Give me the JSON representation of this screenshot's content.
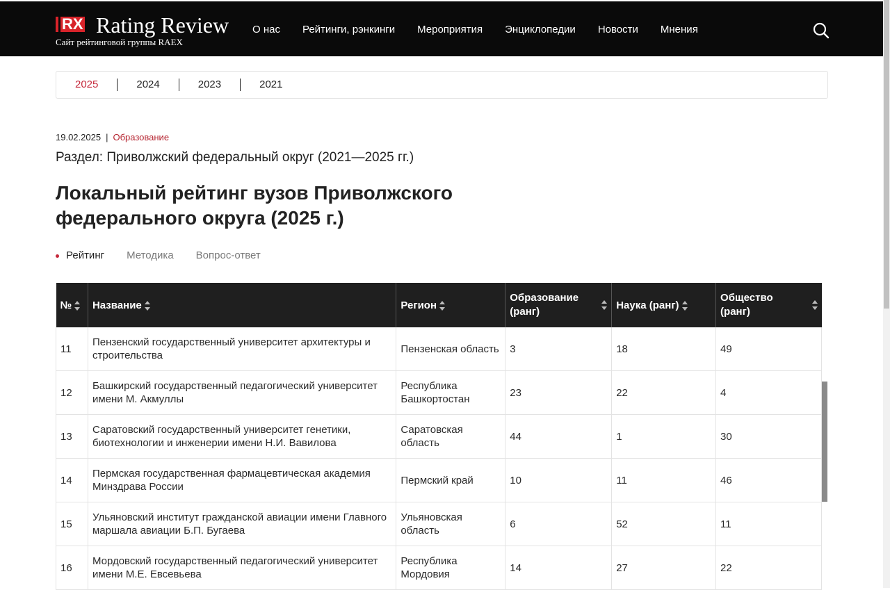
{
  "header": {
    "logo_mark": "RX",
    "logo_title": "Rating Review",
    "logo_subtitle": "Сайт рейтинговой группы RAEX",
    "nav": [
      "О нас",
      "Рейтинги, рэнкинги",
      "Мероприятия",
      "Энциклопедии",
      "Новости",
      "Мнения"
    ]
  },
  "years": [
    "2025",
    "2024",
    "2023",
    "2021"
  ],
  "meta": {
    "date": "19.02.2025",
    "separator": "|",
    "category": "Образование"
  },
  "section": "Раздел: Приволжский федеральный округ (2021—2025 гг.)",
  "title": "Локальный рейтинг вузов Приволжского федерального округа (2025 г.)",
  "subtabs": [
    "Рейтинг",
    "Методика",
    "Вопрос-ответ"
  ],
  "table": {
    "headers": [
      "№",
      "Название",
      "Регион",
      "Образование (ранг)",
      "Наука (ранг)",
      "Общество (ранг)"
    ],
    "rows": [
      [
        "11",
        "Пензенский государственный университет архитектуры и строительства",
        "Пензенская область",
        "3",
        "18",
        "49"
      ],
      [
        "12",
        "Башкирский государственный педагогический университет имени М. Акмуллы",
        "Республика Башкортостан",
        "23",
        "22",
        "4"
      ],
      [
        "13",
        "Саратовский государственный университет генетики, биотехнологии и инженерии имени Н.И. Вавилова",
        "Саратовская область",
        "44",
        "1",
        "30"
      ],
      [
        "14",
        "Пермская государственная фармацевтическая академия Минздрава России",
        "Пермский край",
        "10",
        "11",
        "46"
      ],
      [
        "15",
        "Ульяновский институт гражданской авиации имени Главного маршала авиации Б.П. Бугаева",
        "Ульяновская область",
        "6",
        "52",
        "11"
      ],
      [
        "16",
        "Мордовский государственный педагогический университет имени М.Е. Евсевьева",
        "Республика Мордовия",
        "14",
        "27",
        "22"
      ]
    ]
  },
  "colors": {
    "accent": "#c5283b",
    "header_bg": "#0a0a0a",
    "table_header_bg": "#1f1f1f"
  }
}
